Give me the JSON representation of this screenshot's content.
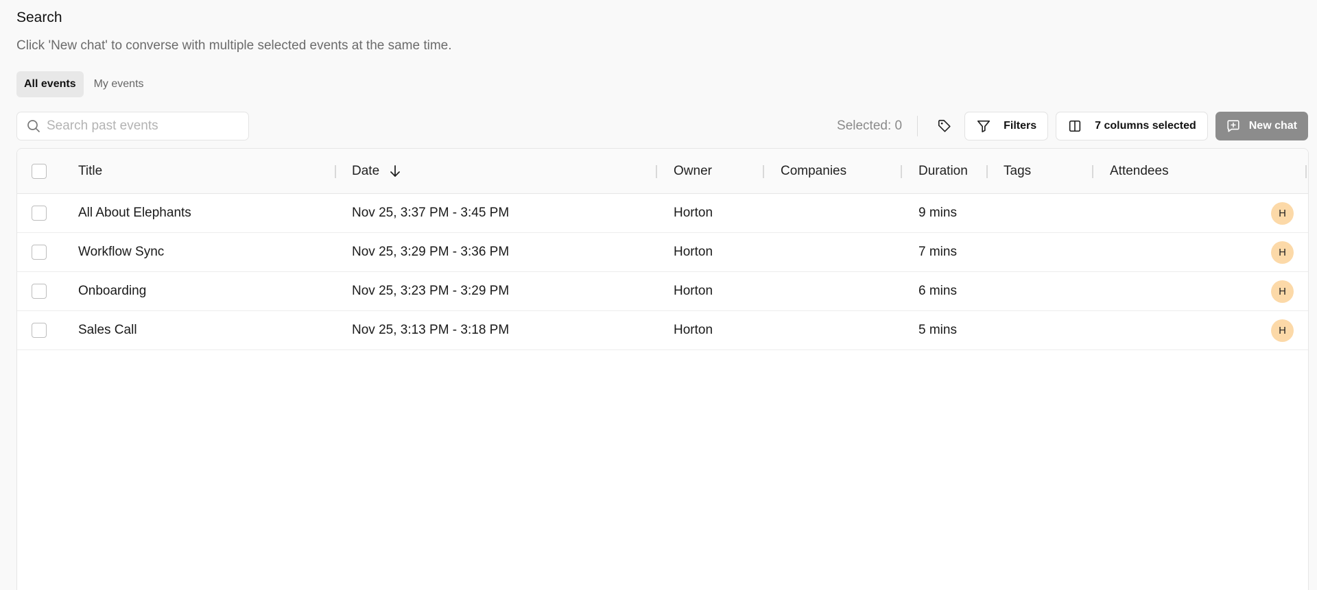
{
  "header": {
    "title": "Search",
    "subtitle": "Click 'New chat' to converse with multiple selected events at the same time."
  },
  "tabs": [
    {
      "label": "All events",
      "active": true
    },
    {
      "label": "My events",
      "active": false
    }
  ],
  "toolbar": {
    "search_placeholder": "Search past events",
    "search_value": "",
    "selected_label": "Selected: 0",
    "filters_label": "Filters",
    "columns_label": "7 columns selected",
    "new_chat_label": "New chat"
  },
  "table": {
    "columns": [
      "Title",
      "Date",
      "Owner",
      "Companies",
      "Duration",
      "Tags",
      "Attendees"
    ],
    "sort": {
      "column": "Date",
      "direction": "descending"
    },
    "rows": [
      {
        "title": "All About Elephants",
        "date": "Nov 25, 3:37 PM - 3:45 PM",
        "owner": "Horton",
        "companies": "",
        "duration": "9 mins",
        "tags": "",
        "attendee_initial": "H"
      },
      {
        "title": "Workflow Sync",
        "date": "Nov 25, 3:29 PM - 3:36 PM",
        "owner": "Horton",
        "companies": "",
        "duration": "7 mins",
        "tags": "",
        "attendee_initial": "H"
      },
      {
        "title": "Onboarding",
        "date": "Nov 25, 3:23 PM - 3:29 PM",
        "owner": "Horton",
        "companies": "",
        "duration": "6 mins",
        "tags": "",
        "attendee_initial": "H"
      },
      {
        "title": "Sales Call",
        "date": "Nov 25, 3:13 PM - 3:18 PM",
        "owner": "Horton",
        "companies": "",
        "duration": "5 mins",
        "tags": "",
        "attendee_initial": "H"
      }
    ]
  },
  "colors": {
    "background": "#f9f9f9",
    "new_chat_button": "#8c8c8c",
    "avatar": "#fcd9a8",
    "active_tab": "#e8e8e8"
  },
  "icons": {
    "search": "search-icon",
    "tag": "tag-icon",
    "filter": "filter-icon",
    "columns": "columns-icon",
    "new_chat": "new-chat-icon",
    "sort": "arrow-down-icon"
  }
}
